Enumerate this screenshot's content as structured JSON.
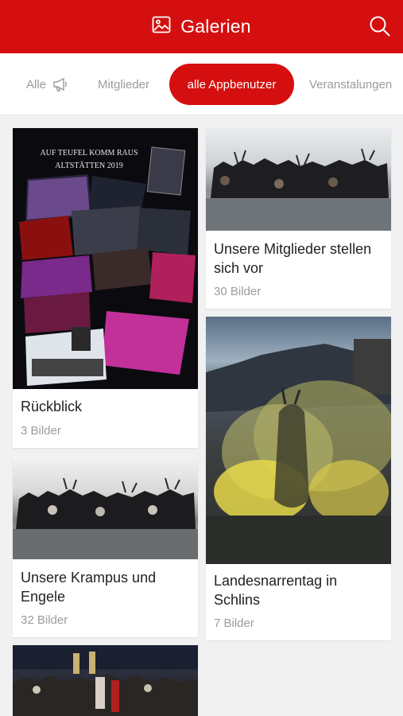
{
  "header": {
    "title": "Galerien",
    "title_icon": "gallery-icon",
    "search_icon": "search-icon",
    "brand_color": "#d50f0f"
  },
  "tabs": [
    {
      "label": "Alle",
      "icon": "megaphone-icon",
      "active": false
    },
    {
      "label": "Mitglieder",
      "active": false
    },
    {
      "label": "alle Appbenutzer",
      "active": true
    },
    {
      "label": "Veranstalungen",
      "active": false
    }
  ],
  "galleries": [
    {
      "title": "Rückblick",
      "count": "3 Bilder",
      "image_text_1": "AUF TEUFEL KOMM RAUS",
      "image_text_2": "ALTSTÄTTEN 2019"
    },
    {
      "title": "Unsere Mitglieder stellen sich vor",
      "count": "30 Bilder"
    },
    {
      "title": "Unsere Krampus und Engele",
      "count": "32 Bilder"
    },
    {
      "title": "Landesnarrentag in Schlins",
      "count": "7 Bilder"
    },
    {
      "title": "",
      "count": ""
    }
  ]
}
